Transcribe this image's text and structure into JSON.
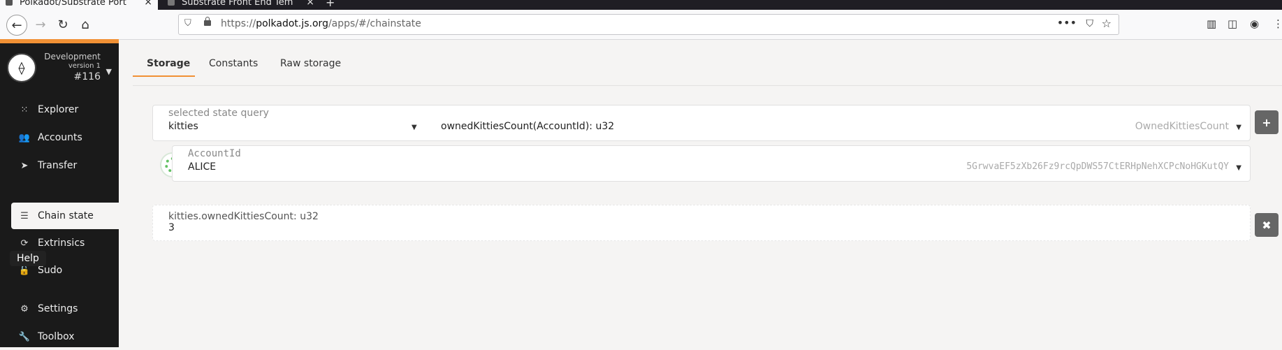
{
  "browser": {
    "tabs": [
      {
        "title": "Polkadot/Substrate Port",
        "close": "×"
      },
      {
        "title": "Substrate Front End Tem",
        "close": "×"
      }
    ],
    "new_tab": "+",
    "url_prefix": "https://",
    "url_host": "polkadot.js.org",
    "url_path": "/apps/#/chainstate",
    "nav": {
      "back": "←",
      "forward": "→",
      "reload": "↻",
      "home": "⌂"
    },
    "toolbar_icons": {
      "library": "▥",
      "sidebar": "◫",
      "account": "◉",
      "more": "⋮"
    }
  },
  "chain": {
    "name": "Development",
    "version": "version 1",
    "block": "#116"
  },
  "sidebar": {
    "items": [
      {
        "label": "Explorer",
        "icon": "⁙"
      },
      {
        "label": "Accounts",
        "icon": "👥"
      },
      {
        "label": "Transfer",
        "icon": "➤"
      },
      {
        "label": "Chain state",
        "icon": "☰"
      },
      {
        "label": "Extrinsics",
        "icon": "⟳"
      },
      {
        "label": "Sudo",
        "icon": "🔓"
      },
      {
        "label": "Settings",
        "icon": "⚙"
      },
      {
        "label": "Toolbox",
        "icon": "🔧"
      }
    ],
    "tooltip": "Help"
  },
  "app_tabs": [
    "Storage",
    "Constants",
    "Raw storage"
  ],
  "query": {
    "label": "selected state query",
    "module": "kitties",
    "signature": "ownedKittiesCount(AccountId): u32",
    "method": "OwnedKittiesCount"
  },
  "account": {
    "label": "AccountId",
    "name": "ALICE",
    "address": "5GrwvaEF5zXb26Fz9rcQpDWS57CtERHpNehXCPcNoHGKutQY"
  },
  "result": {
    "label": "kitties.ownedKittiesCount: u32",
    "value": "3"
  },
  "buttons": {
    "add": "+",
    "remove": "✖"
  }
}
